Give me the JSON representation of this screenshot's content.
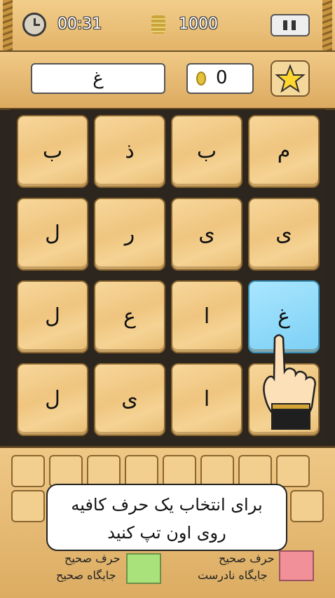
{
  "topbar": {
    "timer": "00:31",
    "coins": "1000"
  },
  "info": {
    "word": "غ",
    "score": "0"
  },
  "board": {
    "tiles": [
      "ب",
      "ذ",
      "ب",
      "م",
      "ل",
      "ر",
      "ی",
      "ی",
      "ل",
      "ع",
      "ا",
      "غ",
      "ل",
      "ی",
      "ا",
      ""
    ]
  },
  "tooltip": {
    "line1": "برای انتخاب یک حرف کافیه",
    "line2": "روی اون تپ کنید"
  },
  "legend": {
    "correct_letter": "حرف صحیح",
    "correct_position": "جایگاه صحیح",
    "incorrect_position": "جایگاه نادرست"
  },
  "colors": {
    "selected": "#7cd0f5",
    "correct": "#a9e27a",
    "incorrect": "#f2909a"
  }
}
